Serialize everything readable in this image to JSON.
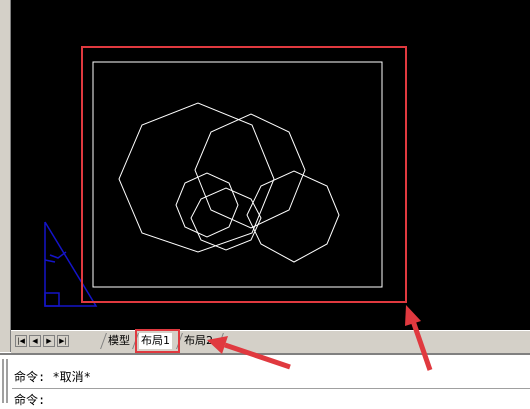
{
  "tabs": {
    "model": "模型",
    "layout1": "布局1",
    "layout2": "布局2"
  },
  "command": {
    "line1": "命令: *取消*",
    "line2": "命令:"
  },
  "nav_buttons": [
    "first-tab",
    "prev-tab",
    "next-tab",
    "last-tab"
  ],
  "colors": {
    "canvas_background": "#000000",
    "drawing_lines": "#ffffff",
    "ucs_icon": "#1414c8",
    "annotation_red": "#e0393f",
    "panel": "#d4d0c8"
  }
}
